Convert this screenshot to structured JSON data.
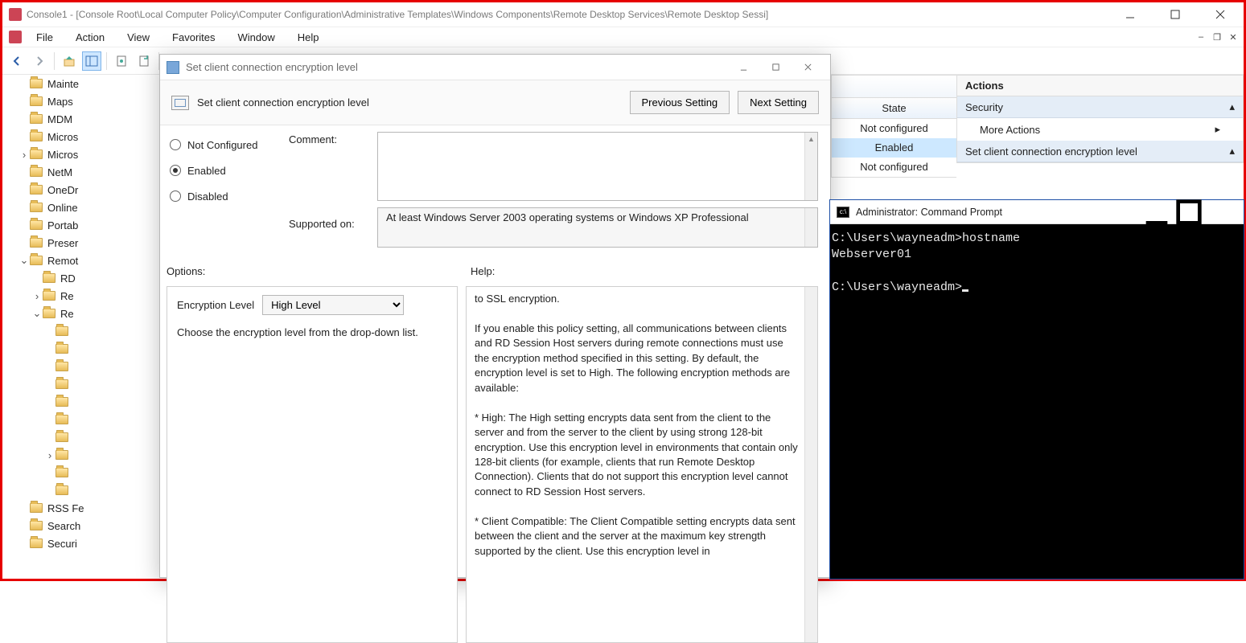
{
  "mmc": {
    "title": "Console1 - [Console Root\\Local Computer Policy\\Computer Configuration\\Administrative Templates\\Windows Components\\Remote Desktop Services\\Remote Desktop Sessi]",
    "menus": [
      "File",
      "Action",
      "View",
      "Favorites",
      "Window",
      "Help"
    ],
    "tree": [
      {
        "label": "Mainte",
        "indent": 0
      },
      {
        "label": "Maps",
        "indent": 0
      },
      {
        "label": "MDM",
        "indent": 0
      },
      {
        "label": "Micros",
        "indent": 0
      },
      {
        "label": "Micros",
        "indent": 0,
        "twisty": ">"
      },
      {
        "label": "NetM",
        "indent": 0
      },
      {
        "label": "OneDr",
        "indent": 0
      },
      {
        "label": "Online",
        "indent": 0
      },
      {
        "label": "Portab",
        "indent": 0
      },
      {
        "label": "Preser",
        "indent": 0
      },
      {
        "label": "Remot",
        "indent": 0,
        "twisty": "v"
      },
      {
        "label": "RD",
        "indent": 1
      },
      {
        "label": "Re",
        "indent": 1,
        "twisty": ">"
      },
      {
        "label": "Re",
        "indent": 1,
        "twisty": "v"
      },
      {
        "label": "",
        "indent": 2
      },
      {
        "label": "",
        "indent": 2
      },
      {
        "label": "",
        "indent": 2
      },
      {
        "label": "",
        "indent": 2
      },
      {
        "label": "",
        "indent": 2
      },
      {
        "label": "",
        "indent": 2
      },
      {
        "label": "",
        "indent": 2
      },
      {
        "label": "",
        "indent": 2,
        "twisty": ">"
      },
      {
        "label": "",
        "indent": 2
      },
      {
        "label": "",
        "indent": 2
      },
      {
        "label": "RSS Fe",
        "indent": 0
      },
      {
        "label": "Search",
        "indent": 0
      },
      {
        "label": "Securi",
        "indent": 0
      }
    ],
    "state_header": "State",
    "state_rows": [
      "Not configured",
      "Enabled",
      "Not configured"
    ],
    "actions": {
      "title": "Actions",
      "group1": "Security",
      "item1": "More Actions",
      "group2": "Set client connection encryption level"
    }
  },
  "dialog": {
    "title": "Set client connection encryption level",
    "heading": "Set client connection encryption level",
    "prev_btn": "Previous Setting",
    "next_btn": "Next Setting",
    "r_notconf": "Not Configured",
    "r_enabled": "Enabled",
    "r_disabled": "Disabled",
    "lbl_comment": "Comment:",
    "lbl_supported": "Supported on:",
    "supported_text": "At least Windows Server 2003 operating systems or Windows XP Professional",
    "lbl_options": "Options:",
    "lbl_help": "Help:",
    "opt_label": "Encryption Level",
    "opt_value": "High Level",
    "opt_hint": "Choose the encryption level from the drop-down list.",
    "help_text": "to SSL encryption.\n\nIf you enable this policy setting, all communications between clients and RD Session Host servers during remote connections must use the encryption method specified in this setting. By default, the encryption level is set to High. The following encryption methods are available:\n\n* High: The High setting encrypts data sent from the client to the server and from the server to the client by using strong 128-bit encryption. Use this encryption level in environments that contain only 128-bit clients (for example, clients that run Remote Desktop Connection). Clients that do not support this encryption level cannot connect to RD Session Host servers.\n\n* Client Compatible: The Client Compatible setting encrypts data sent between the client and the server at the maximum key strength supported by the client. Use this encryption level in"
  },
  "cmd": {
    "title": "Administrator: Command Prompt",
    "line1": "C:\\Users\\wayneadm>hostname",
    "line2": "Webserver01",
    "line3": "",
    "line4": "C:\\Users\\wayneadm>"
  }
}
